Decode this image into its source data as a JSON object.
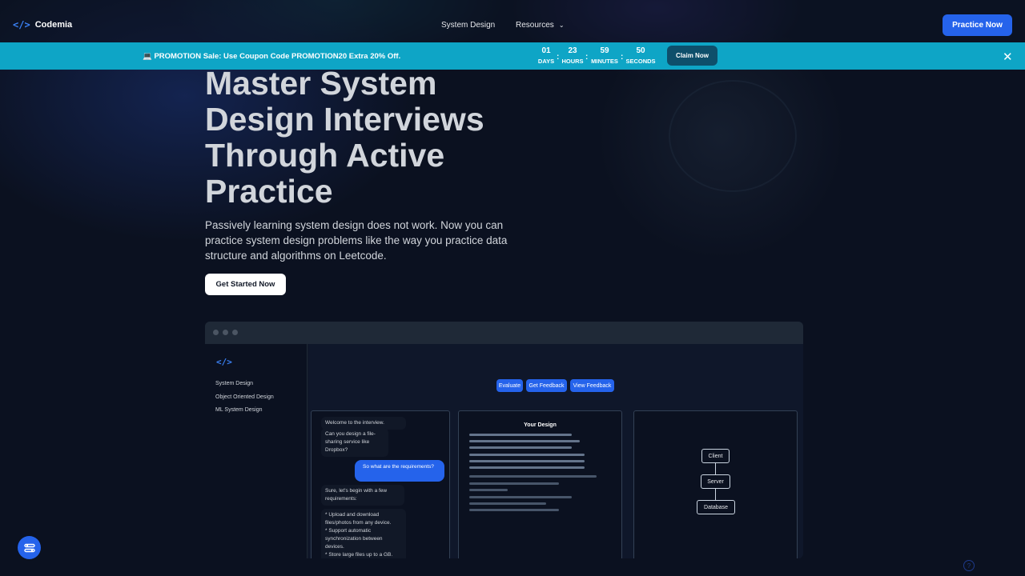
{
  "nav": {
    "logo_icon": "</>",
    "brand": "Codemia",
    "links": [
      "System Design",
      "Resources"
    ],
    "practice_button": "Practice Now"
  },
  "promo": {
    "text": "💻 PROMOTION Sale: Use Coupon Code PROMOTION20 Extra 20% Off.",
    "countdown": [
      {
        "value": "01",
        "label": "DAYS"
      },
      {
        "value": "23",
        "label": "HOURS"
      },
      {
        "value": "59",
        "label": "MINUTES"
      },
      {
        "value": "50",
        "label": "SECONDS"
      }
    ],
    "separator": ":",
    "claim_button": "Claim Now",
    "close": "✕"
  },
  "hero": {
    "title_lines": [
      "Master System",
      "Design Interviews",
      "Through Active",
      "Practice"
    ],
    "subtitle": "Passively learning system design does not work. Now you can practice system design problems like the way you practice data structure and algorithms on Leetcode.",
    "cta": "Get Started Now"
  },
  "mock": {
    "logo_icon": "</>",
    "sidebar": [
      "System Design",
      "Object Oriented Design",
      "ML System Design"
    ],
    "actions": [
      "Evaluate",
      "Get Feedback",
      "View Feedback"
    ],
    "chat": {
      "bot1": "Welcome to the interview.",
      "bot2": "Can you design a file-sharing service like Dropbox?",
      "user": "So what are the requirements?",
      "bot3": "Sure, let's begin with a few requirements:",
      "bot4": "* Upload and download files/photos from any device.\n* Support automatic synchronization between devices.\n* Store large files up to a GB.\n..."
    },
    "design_title": "Your Design",
    "diagram_nodes": [
      "Client",
      "Server",
      "Database"
    ]
  },
  "fab_icon": "settings-sliders-icon",
  "corner_icon": "help-icon"
}
